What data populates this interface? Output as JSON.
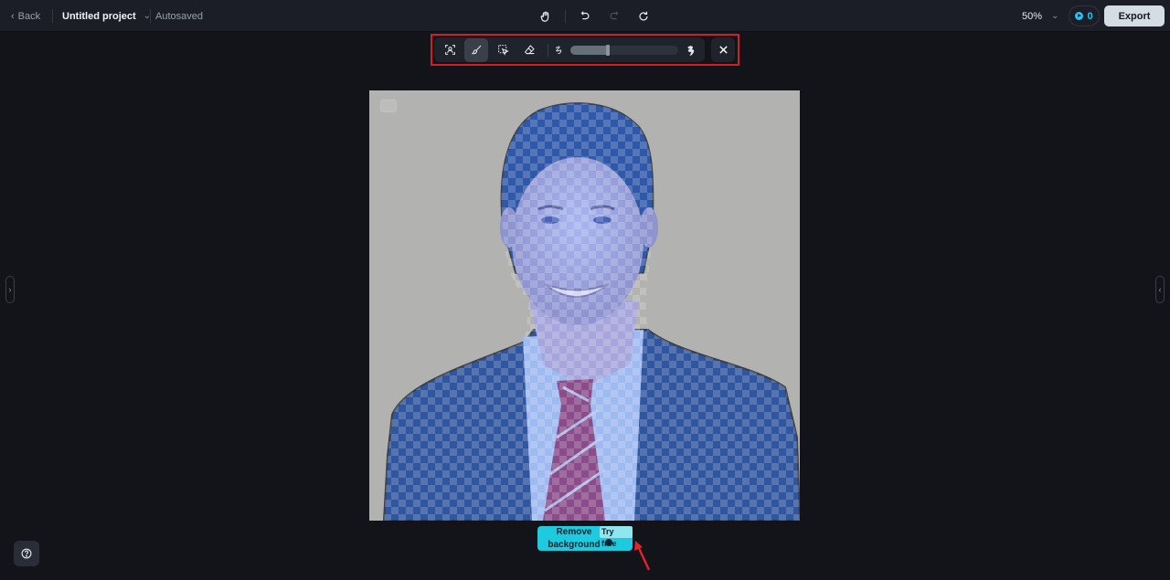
{
  "topbar": {
    "back_label": "Back",
    "project_title": "Untitled project",
    "autosave_status": "Autosaved",
    "tools": [
      {
        "name": "hand-icon"
      },
      {
        "name": "undo-icon"
      },
      {
        "name": "redo-icon",
        "disabled": true
      },
      {
        "name": "refresh-icon"
      }
    ],
    "zoom_level": "50%",
    "credits": "0",
    "export_label": "Export"
  },
  "edit_toolbar": {
    "tools": [
      {
        "name": "select-subject-icon",
        "active": false
      },
      {
        "name": "brush-icon",
        "active": true
      },
      {
        "name": "lasso-select-icon",
        "active": false
      },
      {
        "name": "eraser-icon",
        "active": false
      }
    ],
    "brush_size_percent": 35,
    "min_icon": "thin-stroke-icon",
    "max_icon": "thick-stroke-icon",
    "close_icon": "close-icon"
  },
  "canvas": {
    "subject": "portrait of man in suit with tie",
    "mask_overlay_color": "#2f5cb8"
  },
  "remove_bg": {
    "label_line1": "Remove",
    "label_line2": "background",
    "badge": "Try free",
    "credit_cost": "0"
  },
  "colors": {
    "accent": "#1fc9de",
    "highlight_box": "#d01f27",
    "annotation_arrow": "#e0242b"
  }
}
